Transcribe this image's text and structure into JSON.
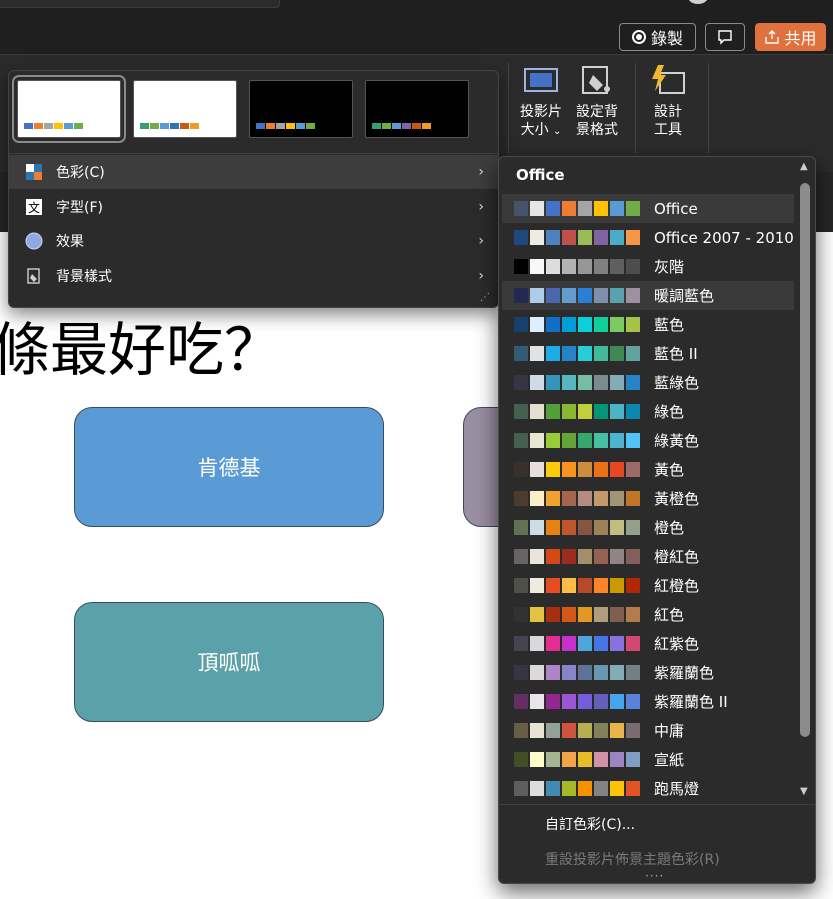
{
  "titlebar": {
    "record_label": "錄製",
    "share_label": "共用"
  },
  "ribbon": {
    "slide_size_label_1": "投影片",
    "slide_size_label_2": "大小",
    "format_bg_label_1": "設定背",
    "format_bg_label_2": "景格式",
    "designer_label_1": "設計",
    "designer_label_2": "工具"
  },
  "variants": {
    "thumbnails": [
      {
        "bg": "#ffffff",
        "colors": [
          "#4472c4",
          "#ed7d31",
          "#a5a5a5",
          "#ffc000",
          "#5b9bd5",
          "#70ad47"
        ]
      },
      {
        "bg": "#ffffff",
        "colors": [
          "#3a9e72",
          "#70ad47",
          "#5b9bd5",
          "#2e75b6",
          "#c55a11",
          "#ed9c2a"
        ]
      },
      {
        "bg": "#000000",
        "colors": [
          "#4472c4",
          "#ed7d31",
          "#a5a5a5",
          "#ffc000",
          "#5b9bd5",
          "#70ad47"
        ]
      },
      {
        "bg": "#000000",
        "colors": [
          "#3a9e72",
          "#70ad47",
          "#5b9bd5",
          "#7e63a8",
          "#c55a11",
          "#ed9c2a"
        ]
      }
    ],
    "menu": [
      {
        "label": "色彩(C)",
        "icon": "palette-icon"
      },
      {
        "label": "字型(F)",
        "icon": "font-icon"
      },
      {
        "label": "效果",
        "icon": "effects-icon"
      },
      {
        "label": "背景樣式",
        "icon": "background-style-icon"
      }
    ]
  },
  "slide": {
    "title": "條最好吃？",
    "shape_kfc": "肯德基",
    "shape_ddd": "頂呱呱"
  },
  "colors_menu": {
    "header": "Office",
    "schemes": [
      {
        "name": "Office",
        "sw": [
          "#44546a",
          "#e7e6e6",
          "#4472c4",
          "#ed7d31",
          "#a5a5a5",
          "#ffc000",
          "#5b9bd5",
          "#70ad47"
        ]
      },
      {
        "name": "Office 2007 - 2010",
        "sw": [
          "#1f497d",
          "#eeece1",
          "#4f81bd",
          "#c0504d",
          "#9bbb59",
          "#8064a2",
          "#4bacc6",
          "#f79646"
        ]
      },
      {
        "name": "灰階",
        "sw": [
          "#000000",
          "#f8f8f8",
          "#dddddd",
          "#b2b2b2",
          "#969696",
          "#808080",
          "#5f5f5f",
          "#4d4d4d"
        ]
      },
      {
        "name": "暖調藍色",
        "sw": [
          "#242852",
          "#acccea",
          "#4a66ac",
          "#629dd1",
          "#297fd5",
          "#7f8fa9",
          "#5aa2ae",
          "#9d90a0"
        ]
      },
      {
        "name": "藍色",
        "sw": [
          "#17406d",
          "#dbefff",
          "#0f6fc6",
          "#009dd9",
          "#0bd0d9",
          "#10cf9b",
          "#7cca62",
          "#a5c249"
        ]
      },
      {
        "name": "藍色 II",
        "sw": [
          "#335b74",
          "#dfe3e5",
          "#1cade4",
          "#2683c6",
          "#27ced7",
          "#42ba97",
          "#3e8853",
          "#62a39f"
        ]
      },
      {
        "name": "藍綠色",
        "sw": [
          "#373545",
          "#cedbe6",
          "#3494ba",
          "#58b6c0",
          "#75bda7",
          "#7a8c8e",
          "#84acb6",
          "#2683c6"
        ]
      },
      {
        "name": "綠色",
        "sw": [
          "#455f51",
          "#e3ded1",
          "#549e39",
          "#8ab833",
          "#c0cf3a",
          "#029676",
          "#4ab5c4",
          "#0989b1"
        ]
      },
      {
        "name": "綠黃色",
        "sw": [
          "#455f51",
          "#e6e6d5",
          "#99cb38",
          "#63a537",
          "#37a76f",
          "#44c1a3",
          "#4eb3cf",
          "#51c3f9"
        ]
      },
      {
        "name": "黃色",
        "sw": [
          "#39302a",
          "#e5dedb",
          "#ffca08",
          "#f8931d",
          "#ce8d3e",
          "#ec7016",
          "#e64823",
          "#9c6a6a"
        ]
      },
      {
        "name": "黃橙色",
        "sw": [
          "#4e3b30",
          "#fbeec9",
          "#f0a22e",
          "#a5644e",
          "#b58b80",
          "#c3986d",
          "#a19574",
          "#c17529"
        ]
      },
      {
        "name": "橙色",
        "sw": [
          "#637052",
          "#ccddea",
          "#e48312",
          "#bd582c",
          "#865640",
          "#9b8357",
          "#c2bc80",
          "#94a088"
        ]
      },
      {
        "name": "橙紅色",
        "sw": [
          "#696464",
          "#e9e5dc",
          "#d34817",
          "#9b2d1f",
          "#a28e6a",
          "#956251",
          "#918485",
          "#855d5d"
        ]
      },
      {
        "name": "紅橙色",
        "sw": [
          "#505046",
          "#eeece1",
          "#e84c22",
          "#ffbd47",
          "#b64926",
          "#ff8427",
          "#cc9900",
          "#b22600"
        ]
      },
      {
        "name": "紅色",
        "sw": [
          "#323232",
          "#e5c243",
          "#a5300f",
          "#d55816",
          "#e19825",
          "#b19c7d",
          "#7f5f52",
          "#b27d49"
        ]
      },
      {
        "name": "紅紫色",
        "sw": [
          "#454551",
          "#d8d9dc",
          "#e32d91",
          "#c830cc",
          "#4ea6dc",
          "#4775e7",
          "#8971e1",
          "#d54773"
        ]
      },
      {
        "name": "紫羅蘭色",
        "sw": [
          "#373545",
          "#dcd8dc",
          "#ad84c6",
          "#8784c7",
          "#5d739a",
          "#6997af",
          "#84acb6",
          "#6f8183"
        ]
      },
      {
        "name": "紫羅蘭色 II",
        "sw": [
          "#632e62",
          "#eae5eb",
          "#92278f",
          "#9b57d3",
          "#755dd9",
          "#665eb8",
          "#45a5ed",
          "#5982db"
        ]
      },
      {
        "name": "中庸",
        "sw": [
          "#675e47",
          "#eae2d5",
          "#93a299",
          "#cf543f",
          "#b5ae53",
          "#848058",
          "#e8b54d",
          "#786c71"
        ]
      },
      {
        "name": "宣紙",
        "sw": [
          "#444d26",
          "#fefac9",
          "#a5b592",
          "#f3a447",
          "#e7bc29",
          "#d092a7",
          "#9c85c0",
          "#809ec2"
        ]
      },
      {
        "name": "跑馬燈",
        "sw": [
          "#5e5e5e",
          "#dddddd",
          "#418ab3",
          "#a6b727",
          "#f69200",
          "#838383",
          "#fec306",
          "#df5327"
        ]
      }
    ],
    "custom_label": "自訂色彩(C)...",
    "reset_label": "重設投影片佈景主題色彩(R)"
  }
}
